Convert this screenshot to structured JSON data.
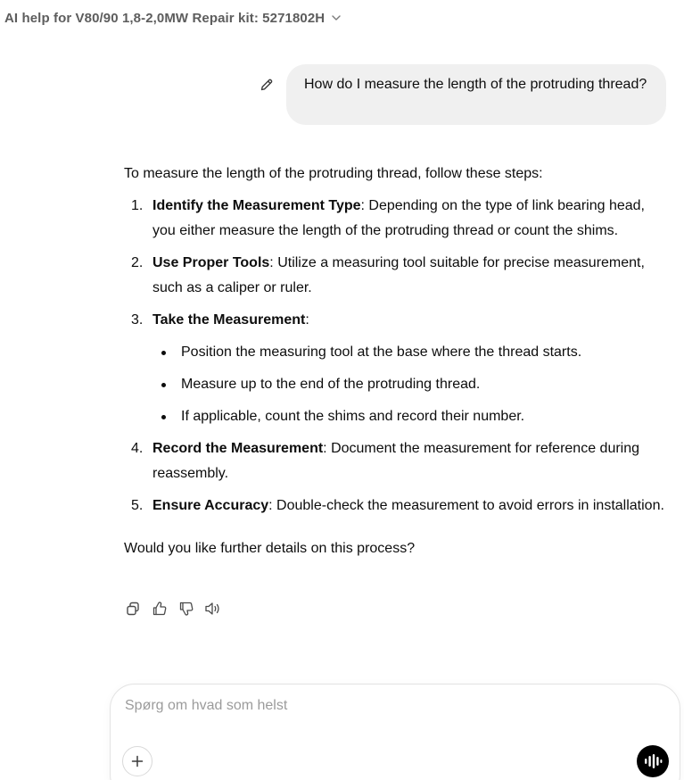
{
  "header": {
    "title": "AI help for V80/90 1,8-2,0MW Repair kit: 5271802H",
    "chevron_icon": "chevron-down-icon"
  },
  "user_message": {
    "text": "How do I measure the length of the protruding thread?",
    "edit_icon": "pencil-icon"
  },
  "assistant_message": {
    "intro": "To measure the length of the protruding thread, follow these steps:",
    "steps": [
      {
        "number": "1.",
        "title": "Identify the Measurement Type",
        "text": ": Depending on the type of link bearing head, you either measure the length of the protruding thread or count the shims."
      },
      {
        "number": "2.",
        "title": "Use Proper Tools",
        "text": ": Utilize a measuring tool suitable for precise measurement, such as a caliper or ruler."
      },
      {
        "number": "3.",
        "title": "Take the Measurement",
        "text": ":",
        "bullets": [
          "Position the measuring tool at the base where the thread starts.",
          "Measure up to the end of the protruding thread.",
          "If applicable, count the shims and record their number."
        ]
      },
      {
        "number": "4.",
        "title": "Record the Measurement",
        "text": ": Document the measurement for reference during reassembly."
      },
      {
        "number": "5.",
        "title": "Ensure Accuracy",
        "text": ": Double-check the measurement to avoid errors in installation."
      }
    ],
    "outro": "Would you like further details on this process?"
  },
  "actions": [
    "copy-icon",
    "thumbs-up-icon",
    "thumbs-down-icon",
    "speaker-icon"
  ],
  "composer": {
    "placeholder": "Spørg om hvad som helst",
    "value": "",
    "plus_icon": "plus-icon",
    "voice_icon": "voice-mode-icon"
  },
  "colors": {
    "user_bubble_bg": "#f0f0f0",
    "header_text": "#5d5d5d",
    "placeholder": "#9b9b9b",
    "voice_button_bg": "#000000"
  }
}
